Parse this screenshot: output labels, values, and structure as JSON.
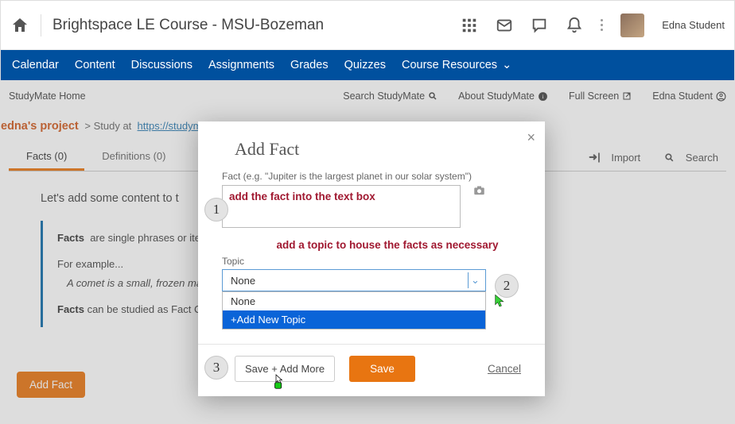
{
  "topbar": {
    "course_title": "Brightspace LE Course - MSU-Bozeman",
    "user_name": "Edna Student"
  },
  "navbar": {
    "items": [
      "Calendar",
      "Content",
      "Discussions",
      "Assignments",
      "Grades",
      "Quizzes",
      "Course Resources"
    ]
  },
  "subnav": {
    "home": "StudyMate Home",
    "search": "Search StudyMate",
    "about": "About StudyMate",
    "full": "Full Screen",
    "user": "Edna Student"
  },
  "crumbs": {
    "project": "edna's project",
    "study_label": "Study at",
    "url": "https://studymat"
  },
  "tabs": {
    "facts": "Facts (0)",
    "defs": "Definitions (0)",
    "import": "Import",
    "search": "Search"
  },
  "content": {
    "intro": "Let's add some content to t",
    "facts_label": "Facts",
    "facts_desc": "are single phrases or ite",
    "example_label": "For example...",
    "example_text": "A comet is a small, frozen mas",
    "study_note_a": "Facts",
    "study_note_b": " can be studied as Fact Ca",
    "add_fact_btn": "Add Fact"
  },
  "modal": {
    "title": "Add Fact",
    "fact_label": "Fact (e.g. \"Jupiter is the largest planet in our solar system\")",
    "annot1": "add the fact into the text box",
    "annot2": "add a topic to house the facts as necessary",
    "topic_label": "Topic",
    "topic_selected": "None",
    "topic_options": [
      "None",
      "+Add New Topic"
    ],
    "save_more": "Save + Add More",
    "save": "Save",
    "cancel": "Cancel"
  },
  "steps": {
    "s1": "1",
    "s2": "2",
    "s3": "3"
  }
}
